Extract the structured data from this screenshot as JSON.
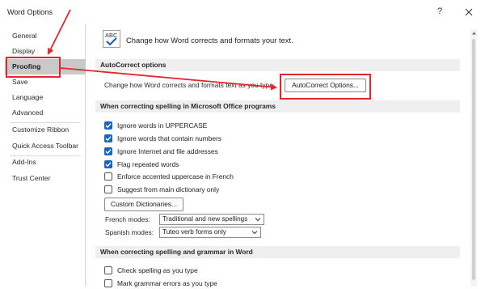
{
  "window": {
    "title": "Word Options",
    "help_glyph": "?",
    "close_icon": "close-icon"
  },
  "sidebar": {
    "items": [
      {
        "label": "General"
      },
      {
        "label": "Display"
      },
      {
        "label": "Proofing",
        "selected": true
      },
      {
        "label": "Save"
      },
      {
        "label": "Language"
      },
      {
        "label": "Advanced"
      },
      {
        "label": "Customize Ribbon"
      },
      {
        "label": "Quick Access Toolbar"
      },
      {
        "label": "Add-Ins"
      },
      {
        "label": "Trust Center"
      }
    ]
  },
  "header": {
    "icon": "abc-checkmark-icon",
    "intro": "Change how Word corrects and formats your text."
  },
  "autocorrect": {
    "title": "AutoCorrect options",
    "description": "Change how Word corrects and formats text as you type:",
    "button_label": "AutoCorrect Options..."
  },
  "spelling_office": {
    "title": "When correcting spelling in Microsoft Office programs",
    "options": [
      {
        "label": "Ignore words in UPPERCASE",
        "checked": true
      },
      {
        "label": "Ignore words that contain numbers",
        "checked": true
      },
      {
        "label": "Ignore Internet and file addresses",
        "checked": true
      },
      {
        "label": "Flag repeated words",
        "checked": true
      },
      {
        "label": "Enforce accented uppercase in French",
        "checked": false
      },
      {
        "label": "Suggest from main dictionary only",
        "checked": false
      }
    ],
    "custom_dictionaries_label": "Custom Dictionaries...",
    "french_modes_label": "French modes:",
    "french_modes_value": "Traditional and new spellings",
    "spanish_modes_label": "Spanish modes:",
    "spanish_modes_value": "Tuteo verb forms only"
  },
  "spelling_word": {
    "title": "When correcting spelling and grammar in Word",
    "options": [
      {
        "label": "Check spelling as you type",
        "checked": false
      },
      {
        "label": "Mark grammar errors as you type",
        "checked": false
      }
    ]
  },
  "annotation": {
    "color": "#e2262b"
  },
  "colors": {
    "checkbox_checked": "#1766c4",
    "nav_selected": "#c9c9c9",
    "section_header_bg": "#efefef"
  }
}
